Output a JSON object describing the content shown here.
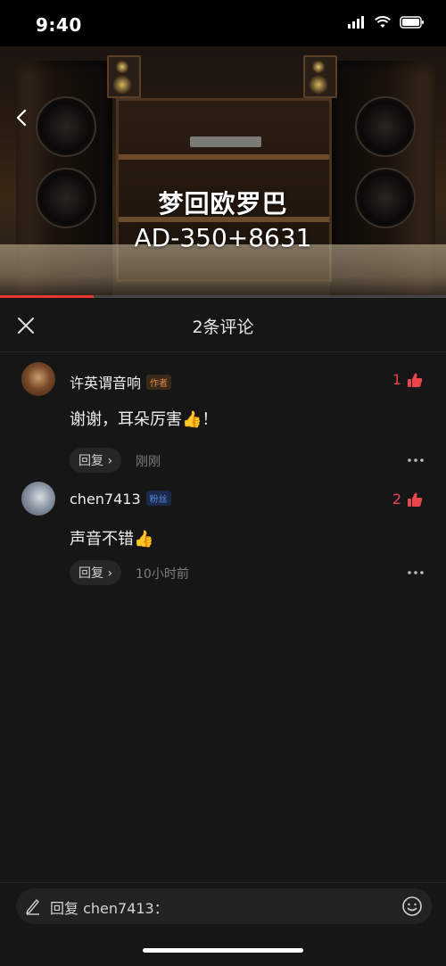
{
  "status": {
    "time": "9:40"
  },
  "video": {
    "title": "梦回欧罗巴",
    "subtitle": "AD-350+8631",
    "progress": 0.21,
    "progress_color": "#e9372f"
  },
  "comments_panel": {
    "title": "2条评论",
    "comments": [
      {
        "username": "许英谓音响",
        "badge": "作者",
        "likes": "1",
        "text": "谢谢，耳朵厉害👍！",
        "reply_label": "回复 ›",
        "time": "刚刚"
      },
      {
        "username": "chen7413",
        "badge": "粉丝",
        "likes": "2",
        "text": "声音不错👍",
        "reply_label": "回复 ›",
        "time": "10小时前"
      }
    ]
  },
  "input": {
    "placeholder": "回复 chen7413："
  },
  "icons": {
    "back": "back-arrow-icon",
    "close": "close-icon",
    "like": "thumbs-up-icon",
    "more": "more-dots-icon",
    "pen": "pen-icon",
    "emoji": "emoji-icon"
  },
  "colors": {
    "accent": "#e9464b",
    "panel_bg": "#161616"
  }
}
